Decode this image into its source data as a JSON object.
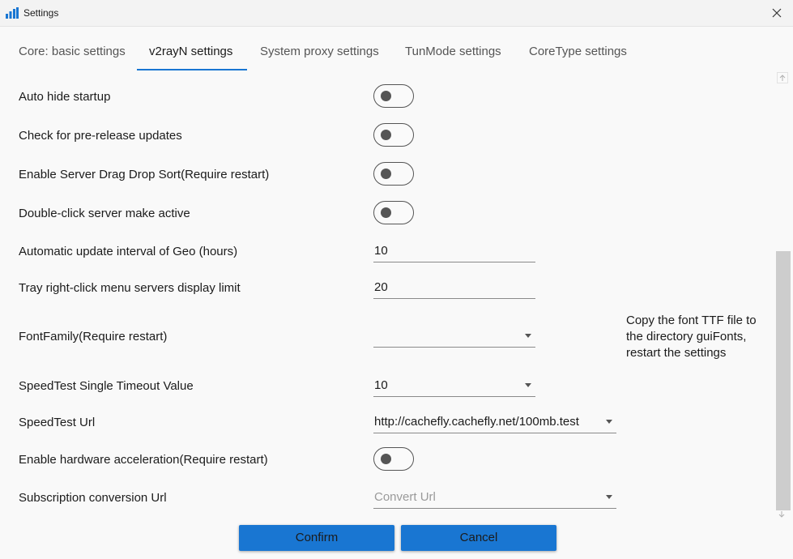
{
  "window": {
    "title": "Settings",
    "icon": "bar-chart-icon",
    "close_icon": "close-icon",
    "accent_color": "#1976d2"
  },
  "tabs": [
    {
      "label": "Core: basic settings",
      "active": false
    },
    {
      "label": "v2rayN settings",
      "active": true
    },
    {
      "label": "System proxy settings",
      "active": false
    },
    {
      "label": "TunMode settings",
      "active": false
    },
    {
      "label": "CoreType settings",
      "active": false
    }
  ],
  "settings": {
    "auto_hide_startup": {
      "label": "Auto hide startup",
      "value": false
    },
    "prerelease_updates": {
      "label": "Check for pre-release updates",
      "value": false
    },
    "drag_drop_sort": {
      "label": "Enable Server Drag Drop Sort(Require restart)",
      "value": false
    },
    "double_click_active": {
      "label": "Double-click server make active",
      "value": false
    },
    "geo_update_interval": {
      "label": "Automatic update interval of Geo (hours)",
      "value": "10"
    },
    "tray_menu_limit": {
      "label": "Tray right-click menu servers display limit",
      "value": "20"
    },
    "font_family": {
      "label": "FontFamily(Require restart)",
      "value": "",
      "hint": "Copy the font TTF file to the directory guiFonts, restart the settings"
    },
    "speedtest_timeout": {
      "label": "SpeedTest Single Timeout Value",
      "value": "10"
    },
    "speedtest_url": {
      "label": "SpeedTest Url",
      "value": "http://cachefly.cachefly.net/100mb.test"
    },
    "hardware_acceleration": {
      "label": "Enable hardware acceleration(Require restart)",
      "value": false
    },
    "subscription_conversion_url": {
      "label": "Subscription conversion Url",
      "value": "",
      "placeholder": "Convert Url"
    }
  },
  "buttons": {
    "confirm": "Confirm",
    "cancel": "Cancel"
  }
}
